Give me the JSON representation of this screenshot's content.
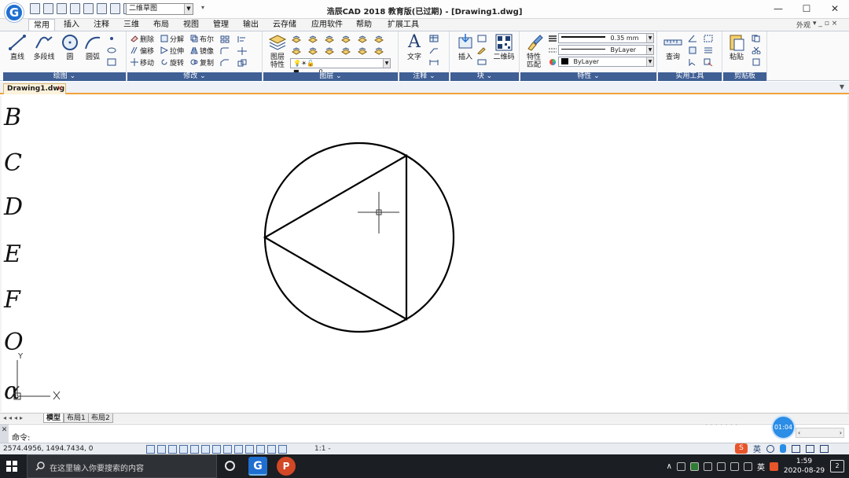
{
  "titlebar": {
    "workspace": "二维草图",
    "title": "浩辰CAD 2018 教育版(已过期) - [Drawing1.dwg]",
    "controls": [
      "—",
      "☐",
      "✕"
    ]
  },
  "tabs": [
    "常用",
    "插入",
    "注释",
    "三维",
    "布局",
    "视图",
    "管理",
    "输出",
    "云存储",
    "应用软件",
    "帮助",
    "扩展工具"
  ],
  "tabs_right": {
    "appearance": "外观",
    "controls": "▾ _ ▫ ×"
  },
  "ribbon": {
    "draw": {
      "label": "绘图 ⌄",
      "line": "直线",
      "polyline": "多段线",
      "circle": "圆",
      "arc": "圆弧"
    },
    "modify": {
      "label": "修改 ⌄",
      "erase": "删除",
      "explode": "分解",
      "boolean": "布尔",
      "offset": "偏移",
      "stretch": "拉伸",
      "mirror": "镜像",
      "move": "移动",
      "rotate": "旋转",
      "copy": "复制"
    },
    "layers": {
      "label": "图层 ⌄",
      "properties_line1": "图层",
      "properties_line2": "特性",
      "current_layer": "0"
    },
    "annotation": {
      "label": "注释 ⌄",
      "text": "文字"
    },
    "block": {
      "label": "块 ⌄",
      "insert": "插入",
      "qrcode": "二维码"
    },
    "properties": {
      "label": "特性 ⌄",
      "match_line1": "特性",
      "match_line2": "匹配",
      "lineweight": "0.35 mm",
      "linetype": "ByLayer",
      "color": "ByLayer"
    },
    "utilities": {
      "label": "实用工具",
      "query": "查询"
    },
    "clipboard": {
      "label": "剪贴板",
      "paste": "粘贴"
    }
  },
  "document": {
    "tab": "Drawing1.dwg",
    "close": "✕"
  },
  "canvas": {
    "letters": [
      "B",
      "C",
      "D",
      "E",
      "F",
      "O",
      "α"
    ],
    "ucs_y": "Y"
  },
  "layout_tabs": [
    "模型",
    "布局1",
    "布局2"
  ],
  "command": {
    "prompt": "命令:",
    "close": "✕"
  },
  "timer": "01:04",
  "status": {
    "coords": "2574.4956, 1494.7434, 0",
    "scale": "1:1 -"
  },
  "taskbar": {
    "search_placeholder": "在这里输入你要搜索的内容",
    "ime": "英",
    "time": "1:59",
    "date": "2020-08-29",
    "notifications": "2"
  },
  "colors": {
    "ribbon_label_bg": "#3f5f95",
    "doc_tab_accent": "#f0a23b",
    "timer_badge": "#2b8de6"
  }
}
